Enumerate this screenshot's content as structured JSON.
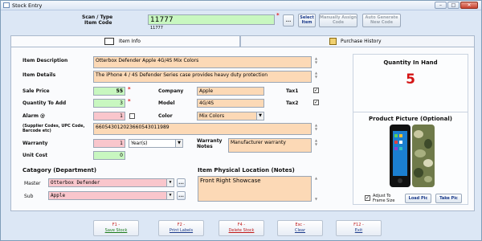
{
  "window": {
    "title": "Stock Entry",
    "minimize": "–",
    "maximize": "□",
    "close": "✕"
  },
  "scan": {
    "label_line1": "Scan / Type",
    "label_line2": "Item Code",
    "value": "11777",
    "sub_value": "11777"
  },
  "top_buttons": {
    "browse": "...",
    "select_item": "Select Item",
    "manually_assign": "Manually Assign Code",
    "auto_generate": "Auto Generate New Code"
  },
  "tabs": [
    {
      "label": "Item Info"
    },
    {
      "label": "Purchase History"
    }
  ],
  "fields": {
    "item_description": {
      "label": "Item Description",
      "value": "Otterbox Defender Apple 4G/4S Mix Colors"
    },
    "item_details": {
      "label": "Item Details",
      "value": "The iPhone 4 / 4S Defender Series case provides heavy duty protection"
    },
    "sale_price": {
      "label": "Sale Price",
      "value": "55"
    },
    "quantity_to_add": {
      "label": "Quantity To Add",
      "value": "3"
    },
    "alarm": {
      "label": "Alarm @",
      "value": "1"
    },
    "company": {
      "label": "Company",
      "value": "Apple"
    },
    "model": {
      "label": "Model",
      "value": "4G/4S"
    },
    "color": {
      "label": "Color",
      "value": "Mix Colors"
    },
    "tax1": {
      "label": "Tax1",
      "checked": "✓"
    },
    "tax2": {
      "label": "Tax2",
      "checked": "✓"
    },
    "supplier_codes": {
      "label": "(Supplier Codes, UPC Code, Barcode etc)",
      "value": "660543012023660543011989"
    },
    "warranty": {
      "label": "Warranty",
      "value": "1",
      "unit": "Year(s)"
    },
    "warranty_notes": {
      "label_line1": "Warranty",
      "label_line2": "Notes",
      "value": "Manufacturer warranty"
    },
    "unit_cost": {
      "label": "Unit Cost",
      "value": "0"
    }
  },
  "category": {
    "section": "Catagory (Department)",
    "master_label": "Master",
    "master_value": "Otterbox Defender",
    "sub_label": "Sub",
    "sub_value": "Apple",
    "btn": "..."
  },
  "location": {
    "section": "Item Physical Location (Notes)",
    "value": "Front Right Showcase"
  },
  "quantity_panel": {
    "title": "Quantity In Hand",
    "value": "5"
  },
  "picture": {
    "title": "Product Picture (Optional)",
    "adjust_label_line1": "Adjust To",
    "adjust_label_line2": "Frame Size",
    "adjust_checked": "✓",
    "load_pic": "Load Pic",
    "take_pic": "Take Pic"
  },
  "footer": [
    {
      "key": "F1 -",
      "action": "Save Stock"
    },
    {
      "key": "F2 -",
      "action": "Print Labels"
    },
    {
      "key": "F4 -",
      "action": "Delete Stock"
    },
    {
      "key": "Esc -",
      "action": "Clear"
    },
    {
      "key": "F12 -",
      "action": "Exit"
    }
  ],
  "colors": {
    "quantity": "#d41414",
    "required_star": "#e02020",
    "peach": "#fcd9b6",
    "pink": "#f9c6cc",
    "green": "#c8f7c0"
  }
}
